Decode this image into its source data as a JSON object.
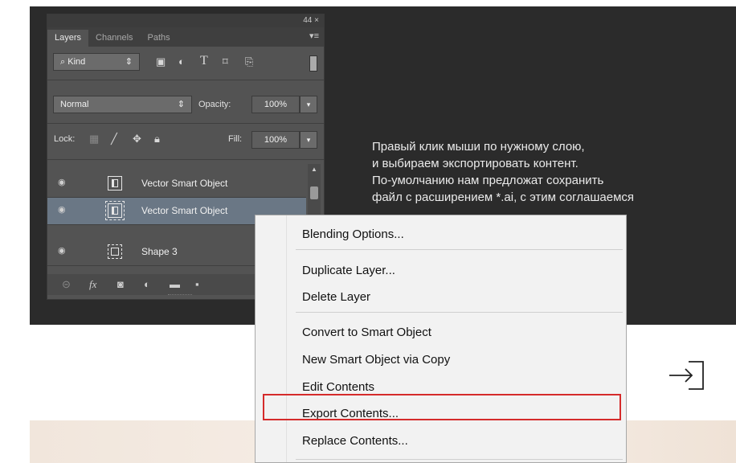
{
  "panel": {
    "title_controls": "44  ×",
    "tabs": [
      {
        "label": "Layers",
        "active": true
      },
      {
        "label": "Channels",
        "active": false
      },
      {
        "label": "Paths",
        "active": false
      }
    ],
    "tab_menu_icon": "panel-menu-icon",
    "filter": {
      "label": "Kind",
      "icons": [
        "image-filter-icon",
        "adjustment-filter-icon",
        "text-filter-icon",
        "shape-filter-icon",
        "smart-object-filter-icon"
      ]
    },
    "blend_mode": "Normal",
    "opacity_label": "Opacity:",
    "opacity_value": "100%",
    "lock_label": "Lock:",
    "fill_label": "Fill:",
    "fill_value": "100%",
    "layers": [
      {
        "name": "Vector Smart Object",
        "type": "smart-object",
        "selected": false
      },
      {
        "name": "Vector Smart Object",
        "type": "smart-object",
        "selected": true
      },
      {
        "name": "Shape 3",
        "type": "shape",
        "selected": false
      }
    ],
    "footer_icons": [
      "link-icon",
      "fx-icon",
      "mask-icon",
      "adjustment-icon",
      "folder-icon",
      "new-layer-icon"
    ]
  },
  "instruction": {
    "lines": [
      "Правый клик мыши по нужному слою,",
      "и выбираем экспортировать контент.",
      "По-умолчанию нам предложат сохранить",
      "файл с расширением *.ai, с этим соглашаемся"
    ]
  },
  "context_menu": {
    "items": [
      "Blending Options...",
      "Duplicate Layer...",
      "Delete Layer",
      "Convert to Smart Object",
      "New Smart Object via Copy",
      "Edit Contents",
      "Export Contents...",
      "Replace Contents..."
    ],
    "highlighted": "Export Contents..."
  },
  "colors": {
    "dark_background": "#2b2b2b",
    "panel": "#535353",
    "selected_layer": "#6a7785",
    "highlight_border": "#d52b2b"
  }
}
